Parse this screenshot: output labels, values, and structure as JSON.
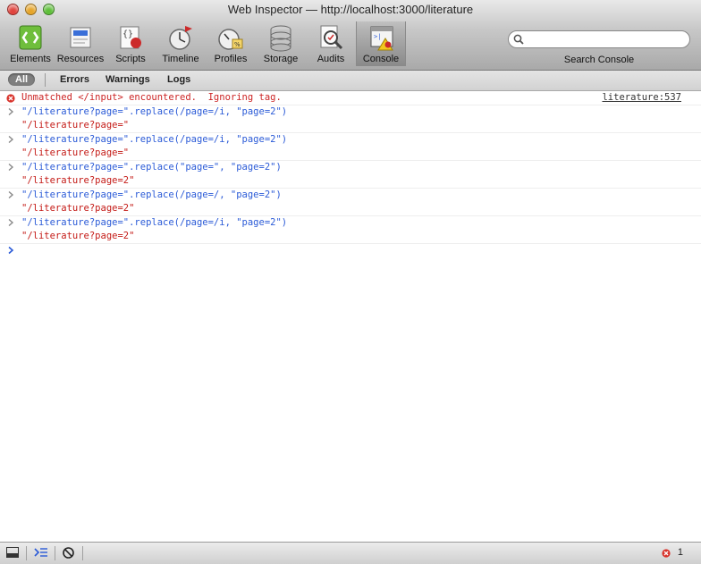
{
  "window": {
    "title": "Web Inspector — http://localhost:3000/literature"
  },
  "toolbar": {
    "items": [
      {
        "label": "Elements"
      },
      {
        "label": "Resources"
      },
      {
        "label": "Scripts"
      },
      {
        "label": "Timeline"
      },
      {
        "label": "Profiles"
      },
      {
        "label": "Storage"
      },
      {
        "label": "Audits"
      },
      {
        "label": "Console"
      }
    ],
    "active": "Console"
  },
  "search": {
    "label": "Search Console",
    "value": ""
  },
  "filters": {
    "all": "All",
    "errors": "Errors",
    "warnings": "Warnings",
    "logs": "Logs"
  },
  "console": {
    "error": {
      "text": "Unmatched </input> encountered.  Ignoring tag.",
      "source": "literature:537"
    },
    "entries": [
      {
        "command": "\"/literature?page=\".replace(/page=/i, \"page=2\")",
        "result": "\"/literature?page=\""
      },
      {
        "command": "\"/literature?page=\".replace(/page=/i, \"page=2\")",
        "result": "\"/literature?page=\""
      },
      {
        "command": "\"/literature?page=\".replace(\"page=\", \"page=2\")",
        "result": "\"/literature?page=2\""
      },
      {
        "command": "\"/literature?page=\".replace(/page=/, \"page=2\")",
        "result": "\"/literature?page=2\""
      },
      {
        "command": "\"/literature?page=\".replace(/page=/i, \"page=2\")",
        "result": "\"/literature?page=2\""
      }
    ]
  },
  "status": {
    "error_count": "1"
  },
  "colors": {
    "error": "#cc2424",
    "command": "#2a5ad7",
    "string": "#c41a16"
  }
}
